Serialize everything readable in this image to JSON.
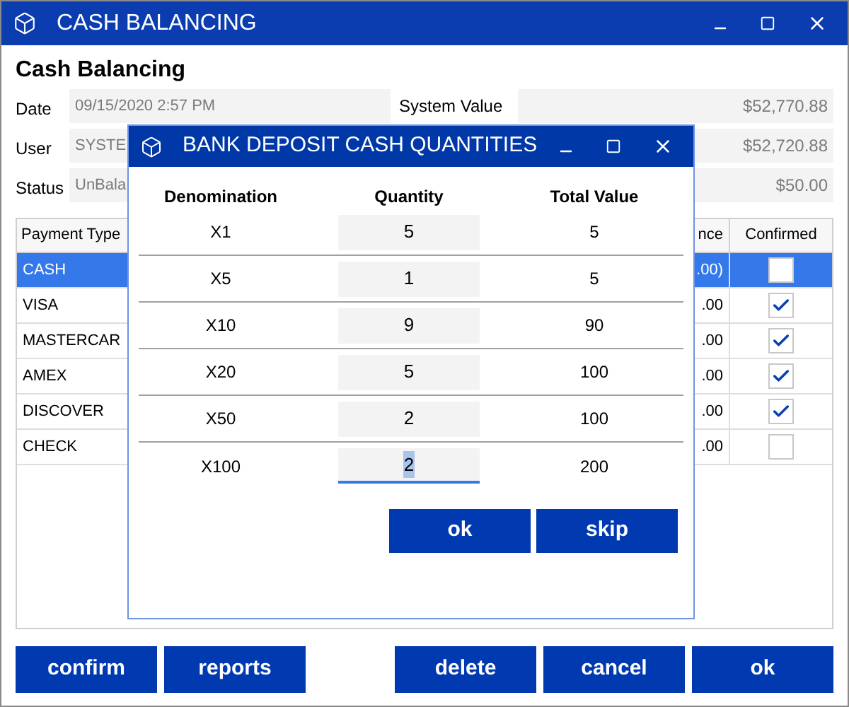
{
  "window": {
    "title": "CASH BALANCING"
  },
  "heading": "Cash Balancing",
  "fields": [
    {
      "label": "Date",
      "value": "09/15/2020 2:57 PM"
    },
    {
      "label": "User",
      "value": "SYSTE"
    },
    {
      "label": "Status",
      "value": "UnBala"
    }
  ],
  "values": [
    {
      "label": "System Value",
      "value": "$52,770.88"
    },
    {
      "value": "$52,720.88"
    },
    {
      "value": "$50.00"
    }
  ],
  "table": {
    "columns": [
      "Payment Type",
      "nce",
      "Confirmed"
    ],
    "rows": [
      {
        "payment_type": "CASH",
        "balance": ".00)",
        "confirmed": false,
        "selected": true
      },
      {
        "payment_type": "VISA",
        "balance": ".00",
        "confirmed": true,
        "selected": false
      },
      {
        "payment_type": "MASTERCAR",
        "balance": ".00",
        "confirmed": true,
        "selected": false
      },
      {
        "payment_type": "AMEX",
        "balance": ".00",
        "confirmed": true,
        "selected": false
      },
      {
        "payment_type": "DISCOVER",
        "balance": ".00",
        "confirmed": true,
        "selected": false
      },
      {
        "payment_type": "CHECK",
        "balance": ".00",
        "confirmed": false,
        "selected": false
      }
    ]
  },
  "buttons_left": [
    "confirm",
    "reports"
  ],
  "buttons_right": [
    "delete",
    "cancel",
    "ok"
  ],
  "dialog": {
    "title": "BANK DEPOSIT CASH QUANTITIES",
    "columns": [
      "Denomination",
      "Quantity",
      "Total Value"
    ],
    "rows": [
      {
        "denomination": "X1",
        "quantity": "5",
        "total": "5",
        "focused": false
      },
      {
        "denomination": "X5",
        "quantity": "1",
        "total": "5",
        "focused": false
      },
      {
        "denomination": "X10",
        "quantity": "9",
        "total": "90",
        "focused": false
      },
      {
        "denomination": "X20",
        "quantity": "5",
        "total": "100",
        "focused": false
      },
      {
        "denomination": "X50",
        "quantity": "2",
        "total": "100",
        "focused": false
      },
      {
        "denomination": "X100",
        "quantity": "2",
        "total": "200",
        "focused": true
      }
    ],
    "buttons": [
      "ok",
      "skip"
    ]
  }
}
